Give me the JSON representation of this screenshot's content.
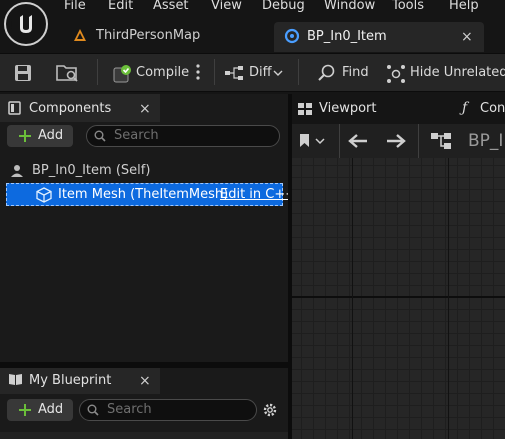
{
  "menu": {
    "items": [
      "File",
      "Edit",
      "Asset",
      "View",
      "Debug",
      "Window",
      "Tools",
      "Help"
    ]
  },
  "tabs": {
    "map_label": "ThirdPersonMap",
    "bp_label": "BP_In0_Item",
    "close_glyph": "×"
  },
  "toolbar": {
    "compile_label": "Compile",
    "diff_label": "Diff",
    "find_label": "Find",
    "hide_unrelated_label": "Hide Unrelated"
  },
  "components": {
    "title": "Components",
    "add_label": "Add",
    "search_placeholder": "Search",
    "tree": {
      "root_label": "BP_In0_Item (Self)",
      "child_label": "Item Mesh (TheItemMesh)",
      "child_link": "Edit in C++"
    }
  },
  "my_blueprint": {
    "title": "My Blueprint",
    "add_label": "Add",
    "search_placeholder": "Search"
  },
  "right_panel": {
    "viewport_tab": "Viewport",
    "construction_tab": "Cons",
    "breadcrumb": "BP_I"
  },
  "colors": {
    "selection": "#0d6adf",
    "compile_ok": "#6bbf3a",
    "add_plus": "#6bbf3a",
    "map_icon": "#e08a1e"
  },
  "icons": [
    "unreal-logo-icon",
    "map-icon",
    "blueprint-icon",
    "save-icon",
    "browse-icon",
    "compile-icon",
    "more-icon",
    "diff-icon",
    "find-icon",
    "hide-unrelated-icon",
    "components-icon",
    "mesh-icon",
    "book-icon",
    "gear-icon",
    "bookmark-icon",
    "arrow-left-icon",
    "arrow-right-icon",
    "hierarchy-icon",
    "function-icon",
    "viewport-icon"
  ]
}
